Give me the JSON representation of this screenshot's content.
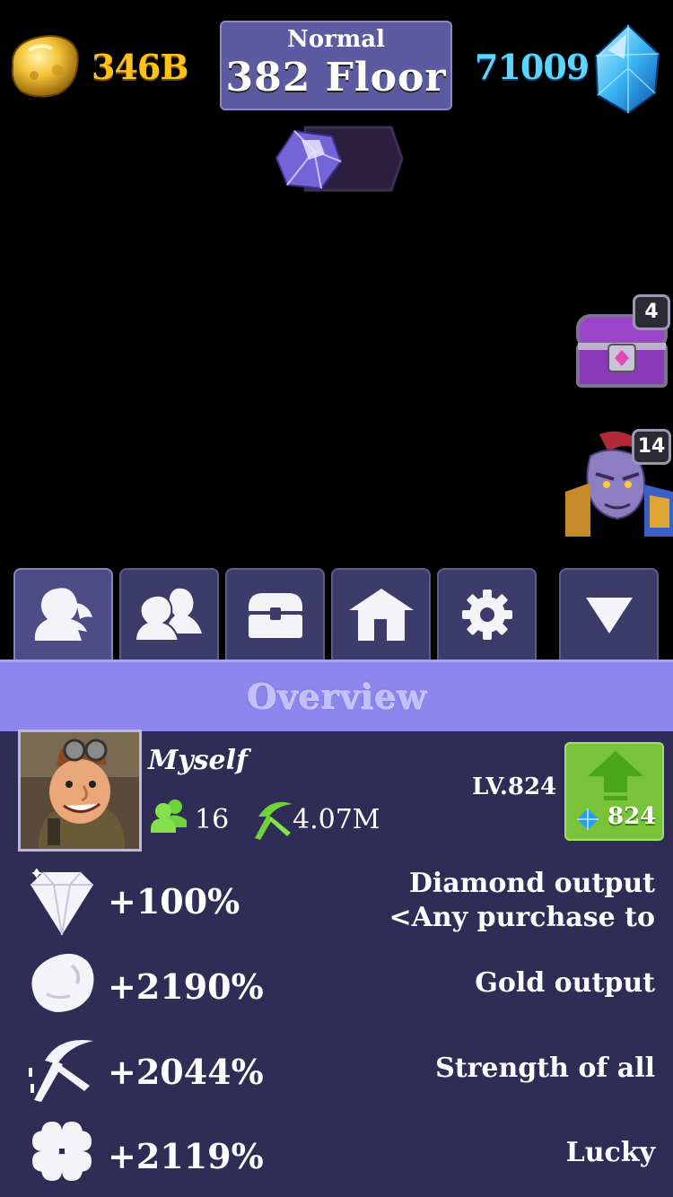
{
  "currency": {
    "gold": "346B",
    "diamonds": "71009"
  },
  "floor": {
    "mode": "Normal",
    "label": "382 Floor"
  },
  "side_buttons": {
    "chest_count": "4",
    "troll_count": "14"
  },
  "tabs": [
    {
      "icon": "user-icon",
      "active": true
    },
    {
      "icon": "users-icon",
      "active": false
    },
    {
      "icon": "chest-icon",
      "active": false
    },
    {
      "icon": "house-icon",
      "active": false
    },
    {
      "icon": "gear-icon",
      "active": false
    },
    {
      "icon": "collapse-triangle-icon",
      "active": false
    }
  ],
  "overview": {
    "title": "Overview"
  },
  "profile": {
    "name": "Myself",
    "friends": "16",
    "power": "4.07M",
    "level": "LV.824",
    "upgrade_cost": "824"
  },
  "stats": [
    {
      "icon": "diamond-icon",
      "value": "+100%",
      "label_line1": "Diamond output",
      "label_line2": "<Any purchase to"
    },
    {
      "icon": "gold-icon",
      "value": "+2190%",
      "label_line1": "Gold output",
      "label_line2": ""
    },
    {
      "icon": "pickaxe-icon",
      "value": "+2044%",
      "label_line1": "Strength of all",
      "label_line2": ""
    },
    {
      "icon": "clover-icon",
      "value": "+2119%",
      "label_line1": "Lucky",
      "label_line2": ""
    }
  ],
  "colors": {
    "gold_text": "#ffc21a",
    "diamond_text": "#58d6ff",
    "panel_bg": "#2f2c55",
    "tab_bg": "#3d3b6a",
    "overview_band": "#8d86ef",
    "upgrade_button": "#79c33a"
  }
}
